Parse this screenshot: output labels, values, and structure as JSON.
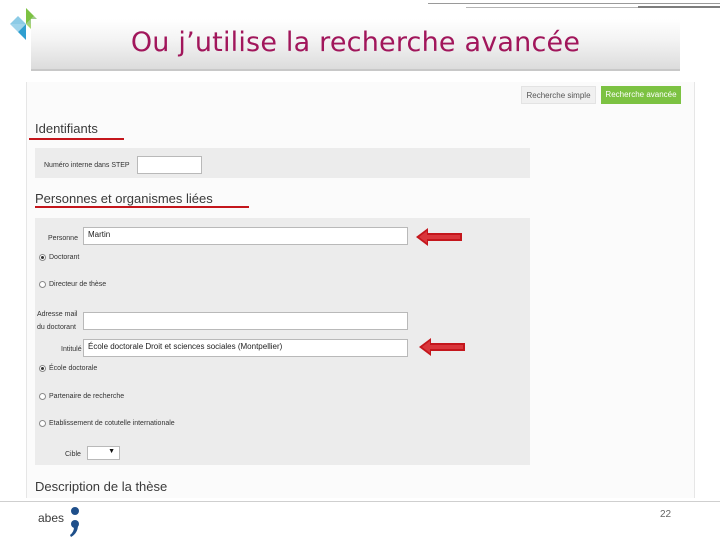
{
  "slide": {
    "title": "Ou j’utilise la recherche avancée",
    "page_number": "22",
    "logo_text": "abes"
  },
  "tabs": {
    "simple": "Recherche simple",
    "advanced": "Recherche avancée"
  },
  "sections": {
    "identifiants": "Identifiants",
    "personnes": "Personnes et organismes liées",
    "description": "Description de la thèse"
  },
  "identifiants": {
    "numero_label": "Numéro interne dans STEP",
    "numero_value": ""
  },
  "personnes": {
    "personne_label": "Personne",
    "personne_value": "Martin",
    "role_options": [
      "Doctorant",
      "Directeur de thèse"
    ],
    "role_selected": "Doctorant",
    "adresse_label_line1": "Adresse mail",
    "adresse_label_line2": "du doctorant",
    "adresse_value": "",
    "intitule_label": "Intitulé",
    "intitule_value": "École doctorale Droit et sciences sociales (Montpellier)",
    "org_options": [
      "École doctorale",
      "Partenaire de recherche",
      "Etablissement de cotutelle internationale"
    ],
    "org_selected": "École doctorale",
    "cible_label": "Cible",
    "cible_value": ""
  },
  "colors": {
    "title": "#a1165b",
    "accent_green": "#7cc242",
    "arrow_red": "#c4161c"
  }
}
